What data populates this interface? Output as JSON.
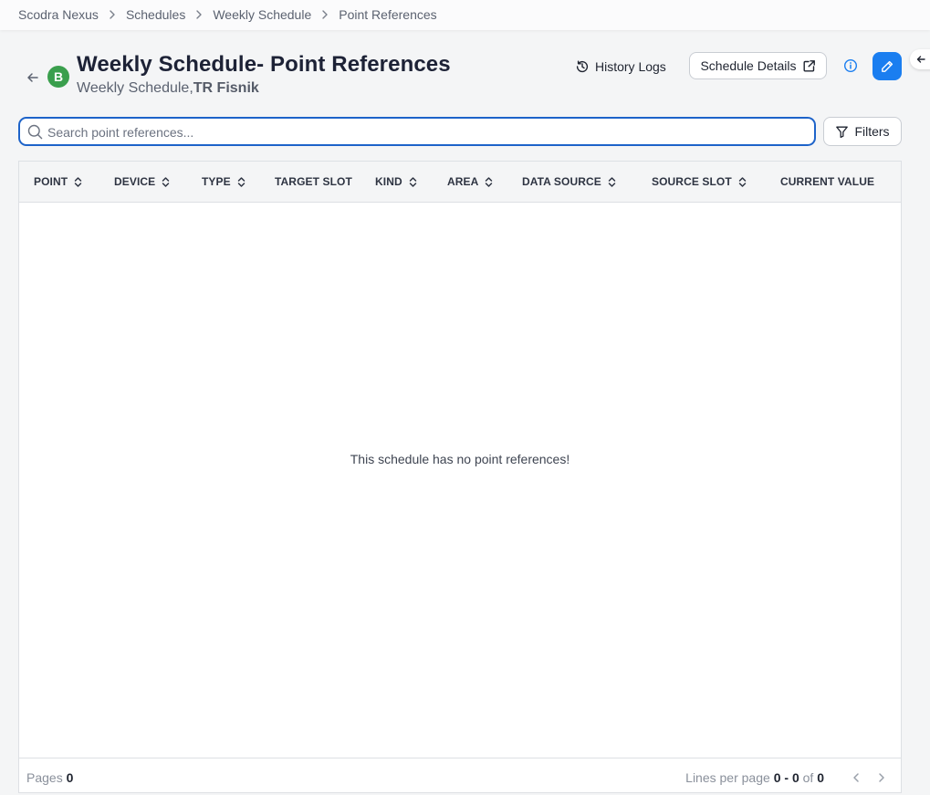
{
  "breadcrumb": [
    "Scodra Nexus",
    "Schedules",
    "Weekly Schedule",
    "Point References"
  ],
  "header": {
    "avatar_letter": "B",
    "title": "Weekly Schedule- Point References",
    "subtitle_prefix": "Weekly Schedule,",
    "subtitle_bold": "TR Fisnik"
  },
  "actions": {
    "history_logs": "History Logs",
    "schedule_details": "Schedule Details"
  },
  "search": {
    "placeholder": "Search point references..."
  },
  "filters_label": "Filters",
  "table": {
    "columns": [
      "POINT",
      "DEVICE",
      "TYPE",
      "TARGET SLOT",
      "KIND",
      "AREA",
      "DATA SOURCE",
      "SOURCE SLOT",
      "CURRENT VALUE"
    ],
    "empty_message": "This schedule has no point references!"
  },
  "footer": {
    "pages_label": "Pages",
    "pages_value": "0",
    "lines_label": "Lines per page",
    "range_start": "0",
    "range_end": "0",
    "of_label": "of",
    "total": "0"
  },
  "colors": {
    "primary": "#1a7ef0",
    "avatar": "#3a9f4d",
    "search_border": "#1d63c9"
  }
}
